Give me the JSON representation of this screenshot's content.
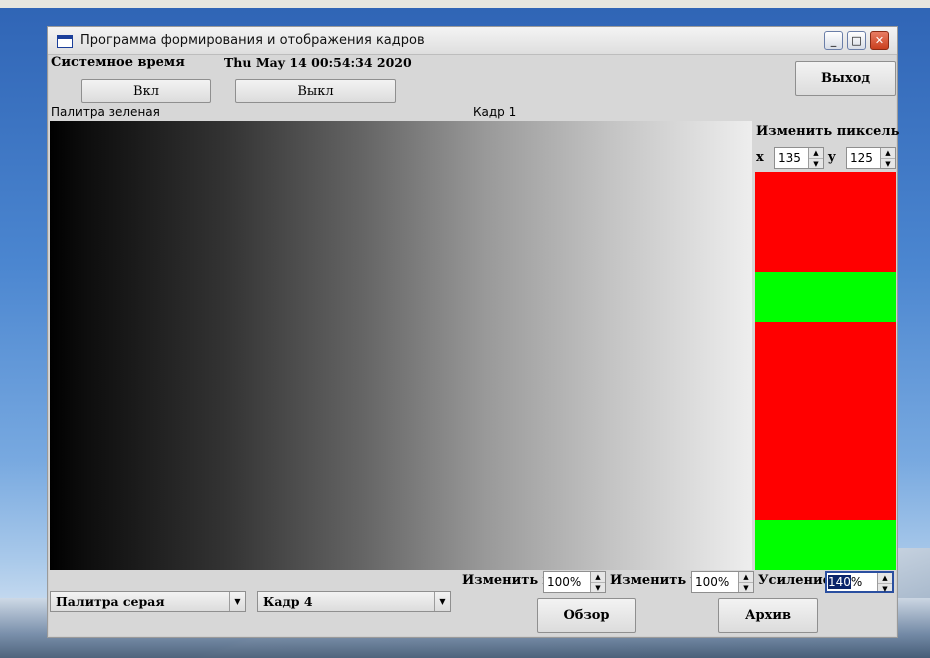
{
  "window": {
    "title": "Программа формирования и отображения кадров",
    "minimize_glyph": "_",
    "maximize_glyph": "□",
    "close_glyph": "✕"
  },
  "header": {
    "system_time_label": "Системное время",
    "system_time_value": "Thu May 14 00:54:34 2020",
    "on_button": "Вкл",
    "off_button": "Выкл",
    "exit_button": "Выход"
  },
  "display": {
    "palette_caption": "Палитра зеленая",
    "frame_caption": "Кадр 1"
  },
  "pixel_editor": {
    "title": "Изменить пиксель",
    "x_label": "x",
    "x_value": "135",
    "y_label": "y",
    "y_value": "125",
    "bands": [
      {
        "color": "#ff0000",
        "start": 0.0,
        "end": 0.2513
      },
      {
        "color": "#00ff00",
        "start": 0.2513,
        "end": 0.3769
      },
      {
        "color": "#ff0000",
        "start": 0.3769,
        "end": 0.8744
      },
      {
        "color": "#00ff00",
        "start": 0.8744,
        "end": 1.0
      }
    ]
  },
  "controls": {
    "palette_select": "Палитра серая",
    "frame_select": "Кадр 4",
    "scale_x_label": "Изменить x",
    "scale_x_value": "100%",
    "scale_y_label": "Изменить y",
    "scale_y_value": "100%",
    "gain_label": "Усиление",
    "gain_value_selected": "140",
    "gain_value_suffix": "%",
    "browse_button": "Обзор",
    "archive_button": "Архив"
  },
  "colors": {
    "selection": "#0a246a",
    "gradient_start": "#000000",
    "gradient_end": "#eeeeee"
  }
}
